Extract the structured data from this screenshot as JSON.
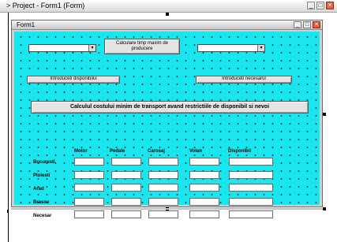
{
  "window": {
    "title": "> Project - Form1 (Form)",
    "min": "_",
    "max": "□",
    "close": "✕"
  },
  "form": {
    "title": "Form1",
    "min": "_",
    "max": "□",
    "close": "✕",
    "background_color": "#19e6ee"
  },
  "controls": {
    "combo_left_arrow": "▾",
    "combo_right_arrow": "▾",
    "button_top_center": "Calculare timp maxim de producere",
    "button_left": "Introduceti disponibilul",
    "button_right": "Introduceti necesarul",
    "button_main": "Calculul costului minim de transport avand restrictiile de disponibil si nevoi"
  },
  "grid": {
    "columns": [
      "Motor",
      "Pedale",
      "Carosaj",
      "Volan",
      "Disponibil"
    ],
    "rows": [
      "Bucuresti",
      "Ploiesti",
      "Arad",
      "Brasov",
      "Necesar"
    ]
  }
}
